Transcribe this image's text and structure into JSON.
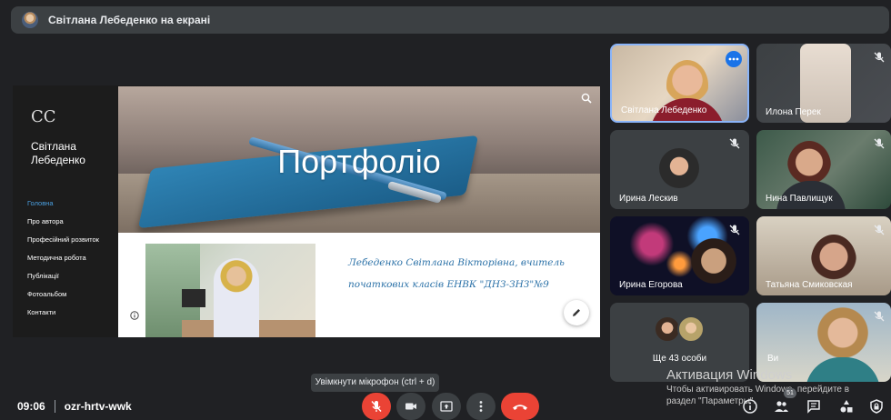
{
  "presenter_bar": {
    "title": "Світлана Лебеденко на екрані"
  },
  "shared_site": {
    "logo": "CC",
    "site_name": "Світлана Лебеденко",
    "nav": [
      "Головна",
      "Про автора",
      "Професійний розвиток",
      "Методична робота",
      "Публікації",
      "Фотоальбом",
      "Контакти"
    ],
    "active_nav": "Головна",
    "hero_title": "Портфоліо",
    "bio": "Лебеденко Світлана Вікторівна, вчитель початкових класів ЕНВК \"ДНЗ-ЗНЗ\"№9"
  },
  "tooltip": "Увімкнути мікрофон (ctrl + d)",
  "participants": [
    {
      "name": "Світлана Лебеденко",
      "muted": false,
      "active": true
    },
    {
      "name": "Илона Перек",
      "muted": true
    },
    {
      "name": "Ирина Лескив",
      "muted": true
    },
    {
      "name": "Нина Павлищук",
      "muted": true
    },
    {
      "name": "Ирина Егорова",
      "muted": true
    },
    {
      "name": "Татьяна Смиковская",
      "muted": true
    },
    {
      "name": "Ще 43 особи",
      "muted": false
    },
    {
      "name": "Ви",
      "muted": true
    }
  ],
  "windows_activation": {
    "heading": "Активация Windows",
    "line1": "Чтобы активировать Windows, перейдите в",
    "line2": "раздел \"Параметры\"."
  },
  "bottom": {
    "time": "09:06",
    "meeting_code": "ozr-hrtv-wwk",
    "participants_badge": "51"
  },
  "colors": {
    "bg": "#202124",
    "tile": "#3c4043",
    "red": "#ea4335",
    "accent": "#8ab4f8",
    "link_active": "#4a9fe0"
  }
}
